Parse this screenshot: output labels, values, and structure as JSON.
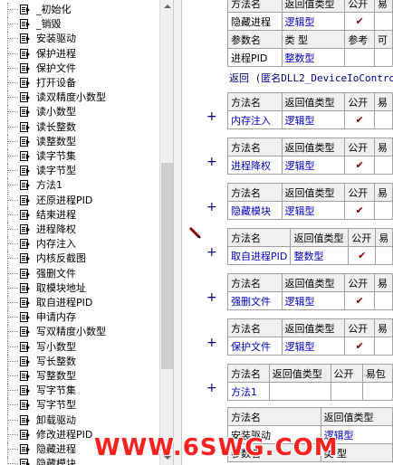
{
  "tree": {
    "items": [
      "_初始化",
      "_销毁",
      "安装驱动",
      "保护进程",
      "保护文件",
      "打开设备",
      "读双精度小数型",
      "读小数型",
      "读长整数",
      "读整数型",
      "读字节集",
      "读字节型",
      "方法1",
      "还原进程PID",
      "结束进程",
      "进程降权",
      "内存注入",
      "内核反截图",
      "强删文件",
      "取模块地址",
      "取自进程PID",
      "申请内存",
      "写双精度小数型",
      "写小数型",
      "写长整数",
      "写整数型",
      "写字节集",
      "写字节型",
      "卸载驱动",
      "修改进程PID",
      "隐藏进程",
      "隐藏模块"
    ]
  },
  "editor": {
    "top_table": {
      "name": "隐藏进程",
      "type": "逻辑型",
      "public": "✔"
    },
    "top_header": {
      "col1": "方法名",
      "col2": "返回值类型",
      "col3": "公开",
      "col4": "易"
    },
    "param_header": {
      "col1": "参数名",
      "col2": "类 型",
      "col3": "参考",
      "col4": "可"
    },
    "param_row": {
      "name": "进程PID",
      "type": "整数型"
    },
    "return_line": "返回 (匿名DLL2_DeviceIoControl",
    "header": {
      "col1": "方法名",
      "col2": "返回值类型",
      "col3": "公开",
      "col4": "易"
    },
    "methods": [
      {
        "name": "内存注入",
        "type": "逻辑型",
        "public": "✔"
      },
      {
        "name": "进程降权",
        "type": "逻辑型",
        "public": "✔"
      },
      {
        "name": "隐藏模块",
        "type": "逻辑型",
        "public": "✔"
      },
      {
        "name": "取自进程PID",
        "type": "整数型",
        "public": "✔"
      },
      {
        "name": "强删文件",
        "type": "逻辑型",
        "public": "✔"
      },
      {
        "name": "保护文件",
        "type": "逻辑型",
        "public": "✔"
      },
      {
        "name": "方法1",
        "type": "",
        "public": ""
      }
    ],
    "last_header": {
      "col1": "方法名",
      "col2": "返回值类型",
      "col3": "公开",
      "col4": "易包"
    },
    "last_table": {
      "name": "安装驱动",
      "type": "逻辑型"
    },
    "last_param_header": {
      "col1": "参数名",
      "col2": "类 型"
    },
    "plus": "+"
  },
  "watermark": "WWW.6SWG.COM"
}
